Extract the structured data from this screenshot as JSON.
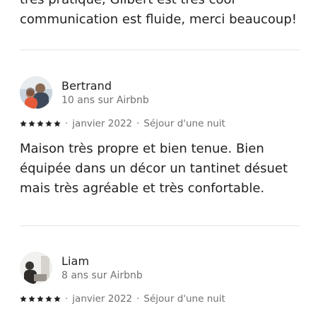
{
  "top_review": {
    "text_line1": "très pratique, Gilbert est très cool",
    "text_line2": "communication est fluide, merci beaucoup!"
  },
  "reviews": [
    {
      "name": "Bertrand",
      "tenure": "10 ans sur Airbnb",
      "rating": 5,
      "date": "janvier 2022",
      "stay": "Séjour d'une nuit",
      "separator": "·",
      "text": "Maison très propre et bien tenue. Bien équipée dans un décor un tantinet désuet mais très agréable et très confortable."
    },
    {
      "name": "Liam",
      "tenure": "8 ans sur Airbnb",
      "rating": 5,
      "date": "janvier 2022",
      "stay": "Séjour d'une nuit",
      "separator": "·"
    }
  ],
  "colors": {
    "text": "#222222",
    "muted": "#717171",
    "divider": "#e6e6e6"
  }
}
